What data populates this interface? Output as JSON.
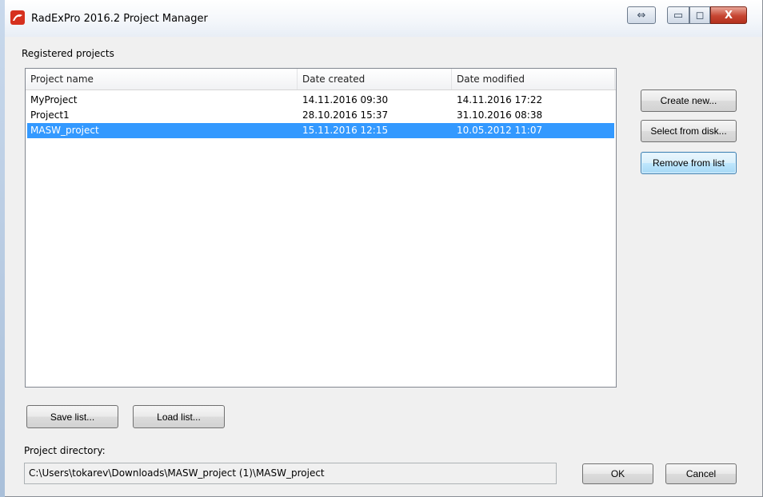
{
  "window": {
    "title": "RadExPro 2016.2  Project Manager",
    "controls": {
      "swap": "⇔",
      "minimize": "▭",
      "maximize": "◻",
      "close": "X"
    }
  },
  "projects": {
    "group_label": "Registered projects",
    "columns": [
      "Project name",
      "Date created",
      "Date modified"
    ],
    "rows": [
      {
        "name": "MyProject",
        "created": "14.11.2016  09:30",
        "modified": "14.11.2016  17:22",
        "selected": false
      },
      {
        "name": "Project1",
        "created": "28.10.2016  15:37",
        "modified": "31.10.2016  08:38",
        "selected": false
      },
      {
        "name": "MASW_project",
        "created": "15.11.2016  12:15",
        "modified": "10.05.2012  11:07",
        "selected": true
      }
    ]
  },
  "side_buttons": {
    "create_new": "Create new...",
    "select_from_disk": "Select from disk...",
    "remove_from_list": "Remove from list"
  },
  "list_buttons": {
    "save_list": "Save list...",
    "load_list": "Load list..."
  },
  "directory": {
    "label": "Project directory:",
    "value": "C:\\Users\\tokarev\\Downloads\\MASW_project (1)\\MASW_project"
  },
  "dialog_buttons": {
    "ok": "OK",
    "cancel": "Cancel"
  },
  "colors": {
    "selection": "#3399ff",
    "focus_button": "#3c7fb1",
    "close_button": "#c64532"
  }
}
